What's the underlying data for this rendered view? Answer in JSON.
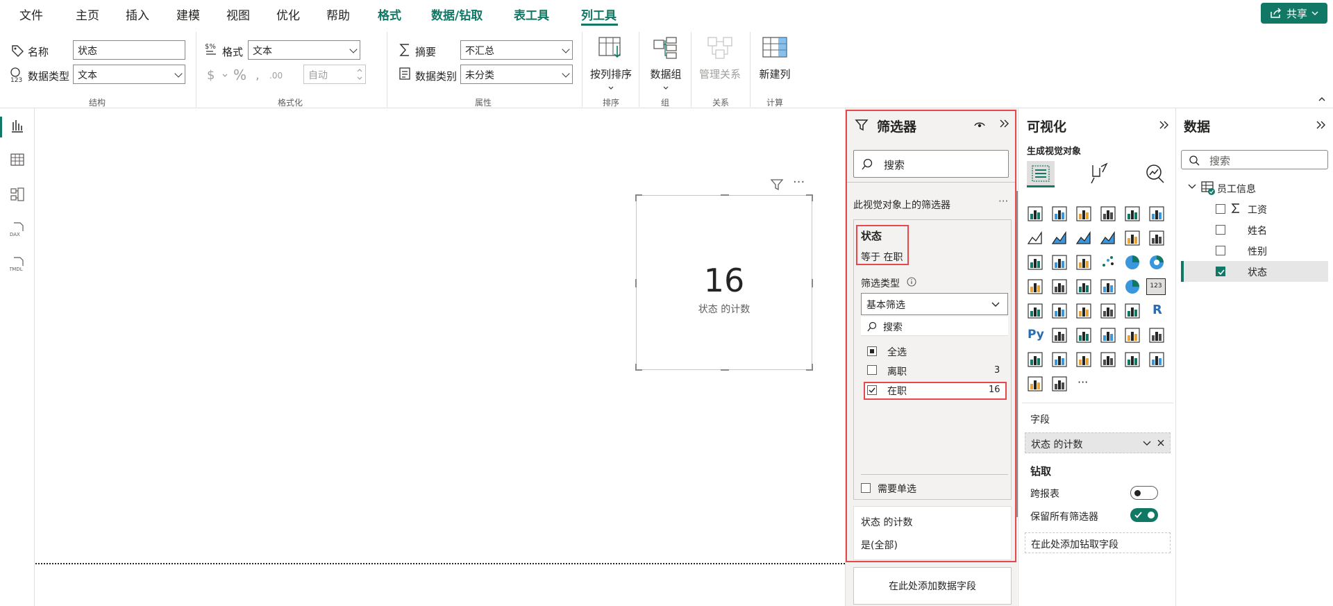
{
  "menu": {
    "items": [
      "文件",
      "主页",
      "插入",
      "建模",
      "视图",
      "优化",
      "帮助"
    ],
    "context_tabs": [
      "格式",
      "数据/钻取",
      "表工具",
      "列工具"
    ],
    "active_tab": "列工具",
    "share_label": "共享"
  },
  "ribbon": {
    "structure": {
      "name_label": "名称",
      "name_value": "状态",
      "datatype_label": "数据类型",
      "datatype_value": "文本",
      "group_name": "结构"
    },
    "formatting": {
      "format_label": "格式",
      "format_value": "文本",
      "auto_value": "自动",
      "group_name": "格式化"
    },
    "properties": {
      "summary_label": "摘要",
      "summary_value": "不汇总",
      "category_label": "数据类别",
      "category_value": "未分类",
      "group_name": "属性"
    },
    "sort": {
      "button_label": "按列排序",
      "group_name": "排序"
    },
    "groups": {
      "button_label": "数据组",
      "group_name": "组"
    },
    "relations": {
      "button_label": "管理关系",
      "group_name": "关系"
    },
    "calc": {
      "button_label": "新建列",
      "group_name": "计算"
    }
  },
  "canvas": {
    "card_value": "16",
    "card_label": "状态 的计数"
  },
  "filters": {
    "title": "筛选器",
    "search_placeholder": "搜索",
    "section_title": "此视觉对象上的筛选器",
    "filter_card": {
      "field": "状态",
      "summary": "等于 在职",
      "type_label": "筛选类型",
      "type_value": "基本筛选",
      "search_placeholder": "搜索",
      "options": [
        {
          "label": "全选",
          "count": "",
          "state": "partial"
        },
        {
          "label": "离职",
          "count": "3",
          "state": "unchecked"
        },
        {
          "label": "在职",
          "count": "16",
          "state": "checked"
        }
      ],
      "require_single_label": "需要单选"
    },
    "second_card": {
      "field": "状态 的计数",
      "summary": "是(全部)"
    },
    "add_field_label": "在此处添加数据字段"
  },
  "visualizations": {
    "title": "可视化",
    "build_label": "生成视觉对象",
    "fields_label": "字段",
    "field_value": "状态 的计数",
    "drill_label": "钻取",
    "cross_report_label": "跨报表",
    "keep_filters_label": "保留所有筛选器",
    "cross_report_on": false,
    "keep_filters_on": true,
    "add_drill_label": "在此处添加钻取字段",
    "r_icon_text": "R",
    "py_icon_text": "Py",
    "more_text": "···",
    "card_icon_text": "123"
  },
  "data": {
    "title": "数据",
    "search_placeholder": "搜索",
    "table_name": "员工信息",
    "fields": [
      {
        "name": "工资",
        "sigma": true,
        "checked": false
      },
      {
        "name": "姓名",
        "sigma": false,
        "checked": false
      },
      {
        "name": "性别",
        "sigma": false,
        "checked": false
      },
      {
        "name": "状态",
        "sigma": false,
        "checked": true
      }
    ]
  },
  "colors": {
    "accent": "#117865",
    "highlight_red": "#e8474c",
    "powerbi_yellow": "#f2c811"
  }
}
